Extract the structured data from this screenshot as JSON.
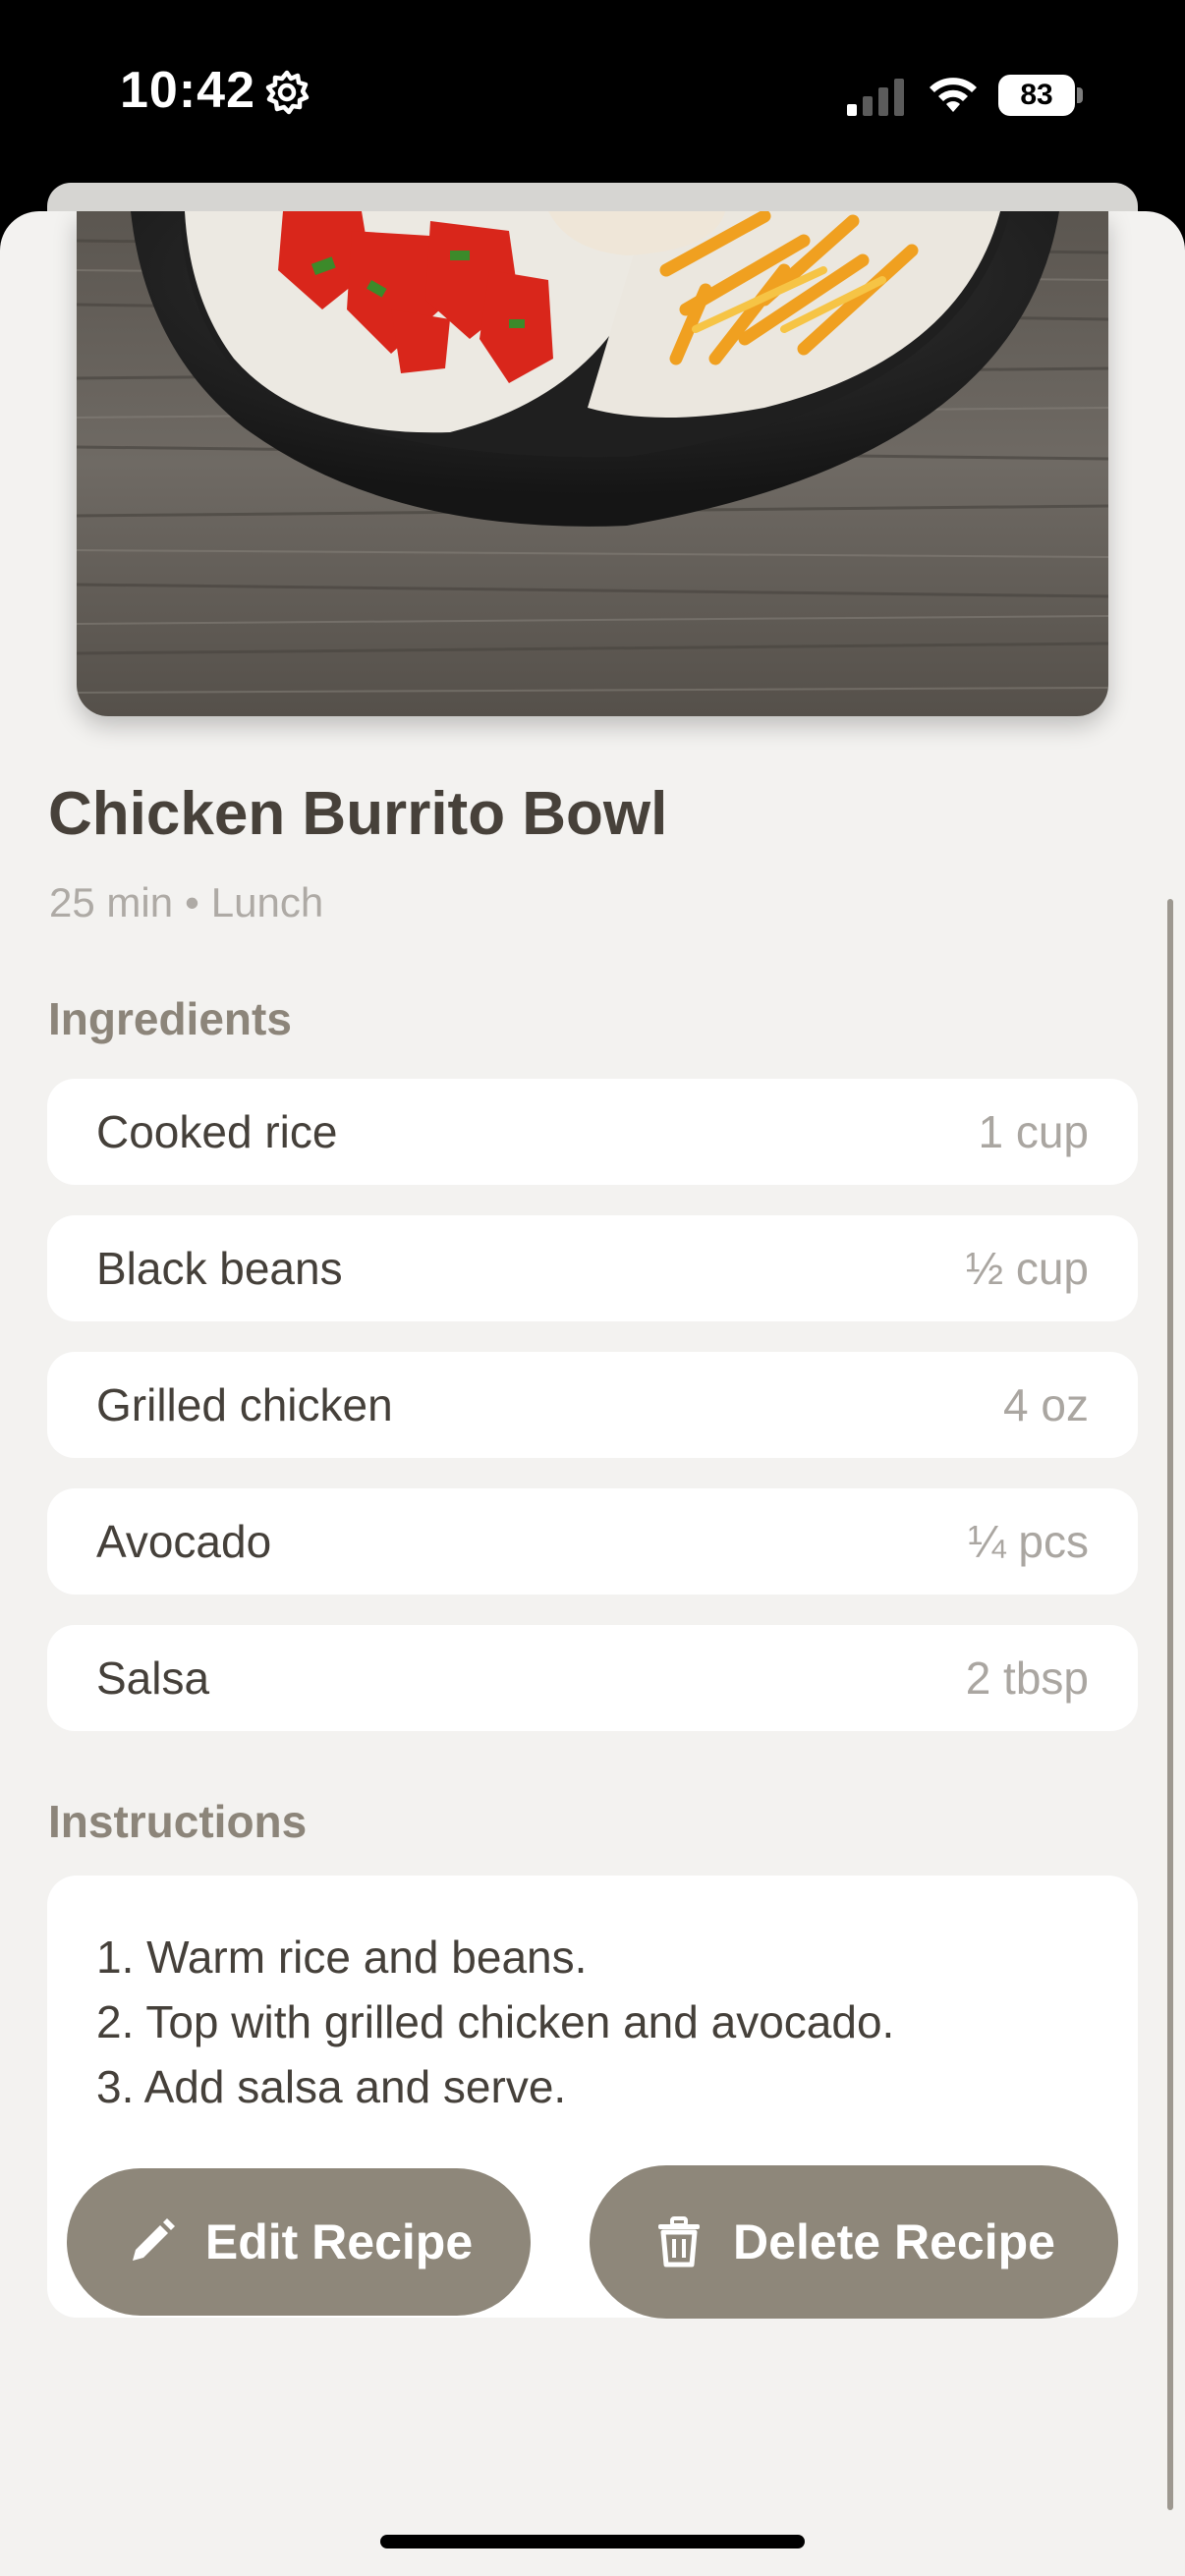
{
  "status_bar": {
    "time": "10:42",
    "battery": "83",
    "icons": [
      "gear-icon",
      "cellular-signal-icon",
      "wifi-icon",
      "battery-icon"
    ]
  },
  "recipe": {
    "title": "Chicken Burrito Bowl",
    "duration": "25 min",
    "separator": "•",
    "meal_type": "Lunch"
  },
  "ingredients": {
    "label": "Ingredients",
    "items": [
      {
        "name": "Cooked rice",
        "quantity": "1 cup"
      },
      {
        "name": "Black beans",
        "quantity": "½ cup"
      },
      {
        "name": "Grilled chicken",
        "quantity": "4 oz"
      },
      {
        "name": "Avocado",
        "quantity": "¼ pcs"
      },
      {
        "name": "Salsa",
        "quantity": "2 tbsp"
      }
    ]
  },
  "instructions": {
    "label": "Instructions",
    "lines": [
      "1. Warm rice and beans.",
      "2. Top with grilled chicken and avocado.",
      "3. Add salsa and serve."
    ]
  },
  "actions": {
    "edit_label": "Edit Recipe",
    "edit_icon": "pencil-icon",
    "delete_label": "Delete Recipe",
    "delete_icon": "trash-icon"
  },
  "colors": {
    "background": "#f3f2f0",
    "card": "#ffffff",
    "button": "#8e877a",
    "title_text": "#47413a",
    "section_label": "#8c857a",
    "muted_text": "#aeaaa5"
  }
}
